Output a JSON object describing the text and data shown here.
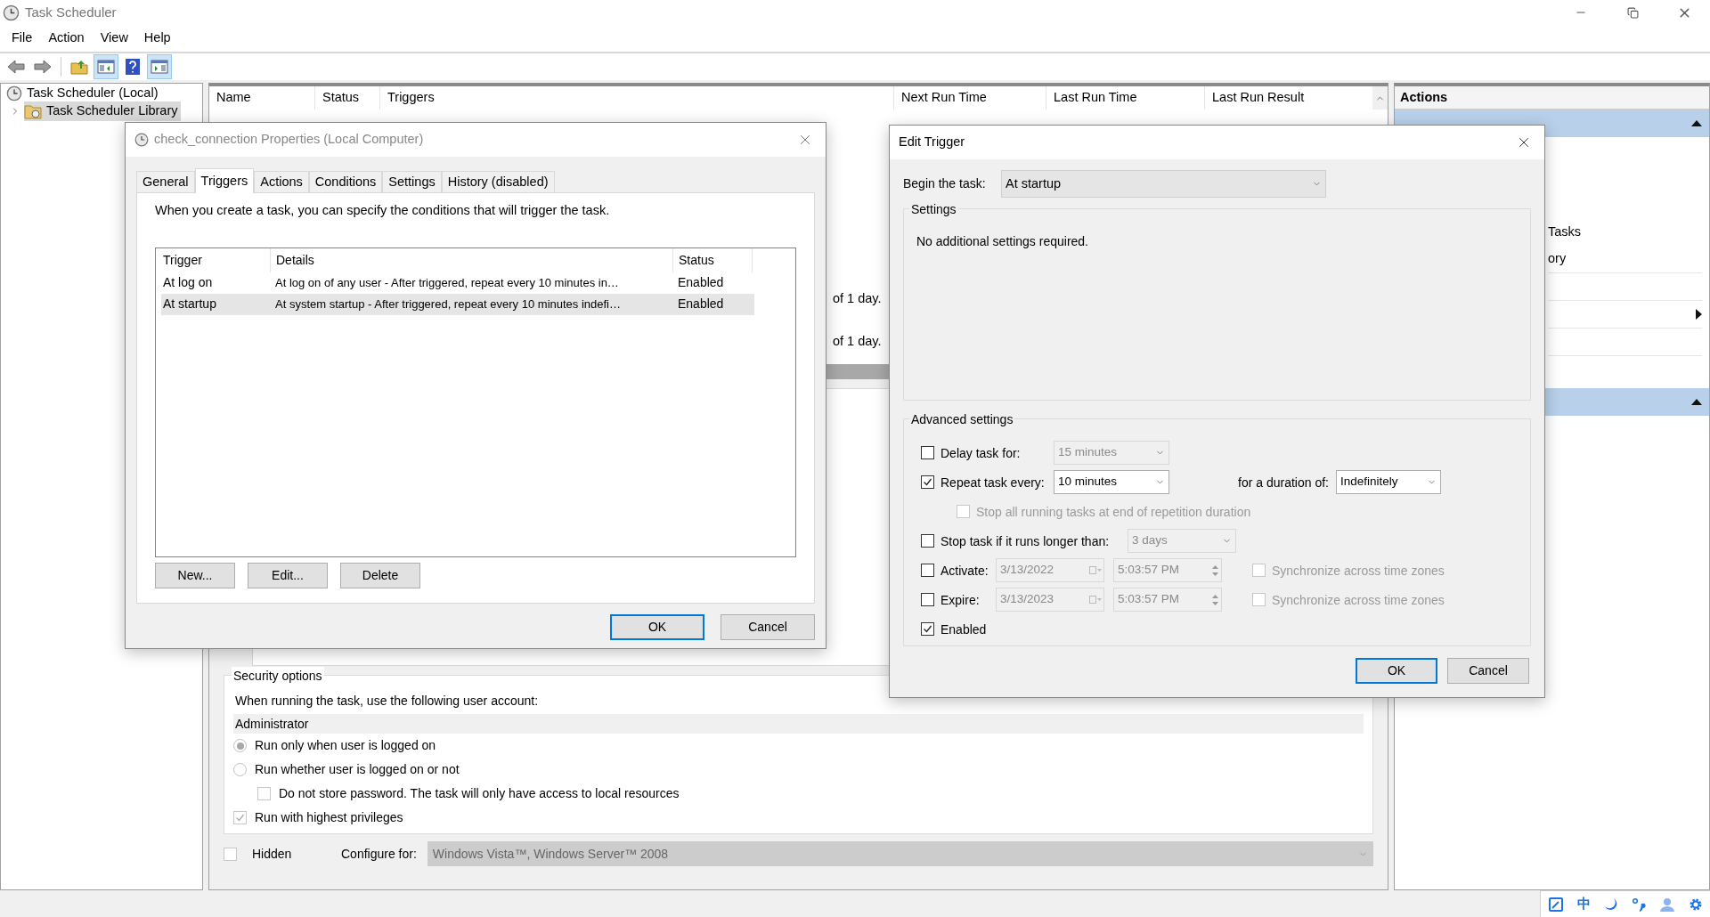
{
  "window": {
    "title": "Task Scheduler"
  },
  "menu": [
    "File",
    "Action",
    "View",
    "Help"
  ],
  "toolbar": [
    {
      "kind": "back",
      "pressed": false
    },
    {
      "kind": "forward",
      "pressed": false
    },
    {
      "kind": "up",
      "pressed": false
    },
    {
      "kind": "tree",
      "pressed": true
    },
    {
      "kind": "help",
      "pressed": false
    },
    {
      "kind": "actions",
      "pressed": true
    }
  ],
  "tree": [
    {
      "label": "Task Scheduler (Local)",
      "selected": false,
      "children": [
        {
          "label": "Task Scheduler Library",
          "selected": true,
          "expanded": false
        }
      ]
    }
  ],
  "task_list": {
    "columns": [
      "Name",
      "Status",
      "Triggers",
      "Next Run Time",
      "Last Run Time",
      "Last Run Result"
    ],
    "row_fragments": [
      "of 1 day.",
      "of 1 day."
    ]
  },
  "general_preview": {
    "security_options": {
      "title": "Security options",
      "account_label": "When running the task, use the following user account:",
      "account": "Administrator",
      "options": [
        {
          "kind": "radio",
          "label": "Run only when user is logged on",
          "selected": true
        },
        {
          "kind": "radio",
          "label": "Run whether user is logged on or not",
          "selected": false,
          "children": [
            {
              "kind": "checkbox",
              "label": "Do not store password.  The task will only have access to local resources",
              "checked": false
            }
          ]
        },
        {
          "kind": "checkbox",
          "label": "Run with highest privileges",
          "checked": true
        }
      ]
    },
    "hidden": {
      "label": "Hidden",
      "checked": false
    },
    "configure_for": {
      "label": "Configure for:",
      "value": "Windows Vista™, Windows Server™ 2008"
    }
  },
  "actions_pane": {
    "title": "Actions",
    "fragments": [
      "Tasks",
      "ory"
    ]
  },
  "tray": {
    "ime_mode": "中"
  },
  "properties_dialog": {
    "title": "check_connection Properties (Local Computer)",
    "tabs": [
      {
        "label": "General",
        "selected": false
      },
      {
        "label": "Triggers",
        "selected": true
      },
      {
        "label": "Actions",
        "selected": false
      },
      {
        "label": "Conditions",
        "selected": false
      },
      {
        "label": "Settings",
        "selected": false
      },
      {
        "label": "History (disabled)",
        "selected": false
      }
    ],
    "description": "When you create a task, you can specify the conditions that will trigger the task.",
    "columns": [
      "Trigger",
      "Details",
      "Status"
    ],
    "rows": [
      {
        "trigger": "At log on",
        "details": "At log on of any user - After triggered, repeat every 10 minutes in…",
        "status": "Enabled",
        "selected": false
      },
      {
        "trigger": "At startup",
        "details": "At system startup - After triggered, repeat every 10 minutes indefi…",
        "status": "Enabled",
        "selected": true
      }
    ],
    "list_buttons": [
      "New...",
      "Edit...",
      "Delete"
    ],
    "buttons": [
      {
        "label": "OK",
        "default": true
      },
      {
        "label": "Cancel",
        "default": false
      }
    ]
  },
  "edit_trigger": {
    "title": "Edit Trigger",
    "begin_label": "Begin the task:",
    "begin_value": "At startup",
    "settings_title": "Settings",
    "settings_text": "No additional settings required.",
    "advanced_title": "Advanced settings",
    "delay": {
      "label": "Delay task for:",
      "checked": false,
      "value": "15 minutes",
      "disabled": true
    },
    "repeat": {
      "label": "Repeat task every:",
      "checked": true,
      "value": "10 minutes",
      "disabled": false,
      "duration_label": "for a duration of:",
      "duration_value": "Indefinitely"
    },
    "stop_all": {
      "label": "Stop all running tasks at end of repetition duration",
      "checked": false,
      "disabled": true
    },
    "stop_longer": {
      "label": "Stop task if it runs longer than:",
      "checked": false,
      "value": "3 days",
      "disabled": true
    },
    "activate": {
      "label": "Activate:",
      "checked": false,
      "date": "3/13/2022",
      "time": "5:03:57 PM",
      "sync_label": "Synchronize across time zones",
      "sync_checked": false,
      "disabled": true
    },
    "expire": {
      "label": "Expire:",
      "checked": false,
      "date": "3/13/2023",
      "time": "5:03:57 PM",
      "sync_label": "Synchronize across time zones",
      "sync_checked": false,
      "disabled": true
    },
    "enabled": {
      "label": "Enabled",
      "checked": true
    },
    "buttons": [
      {
        "label": "OK",
        "default": true
      },
      {
        "label": "Cancel",
        "default": false
      }
    ]
  }
}
